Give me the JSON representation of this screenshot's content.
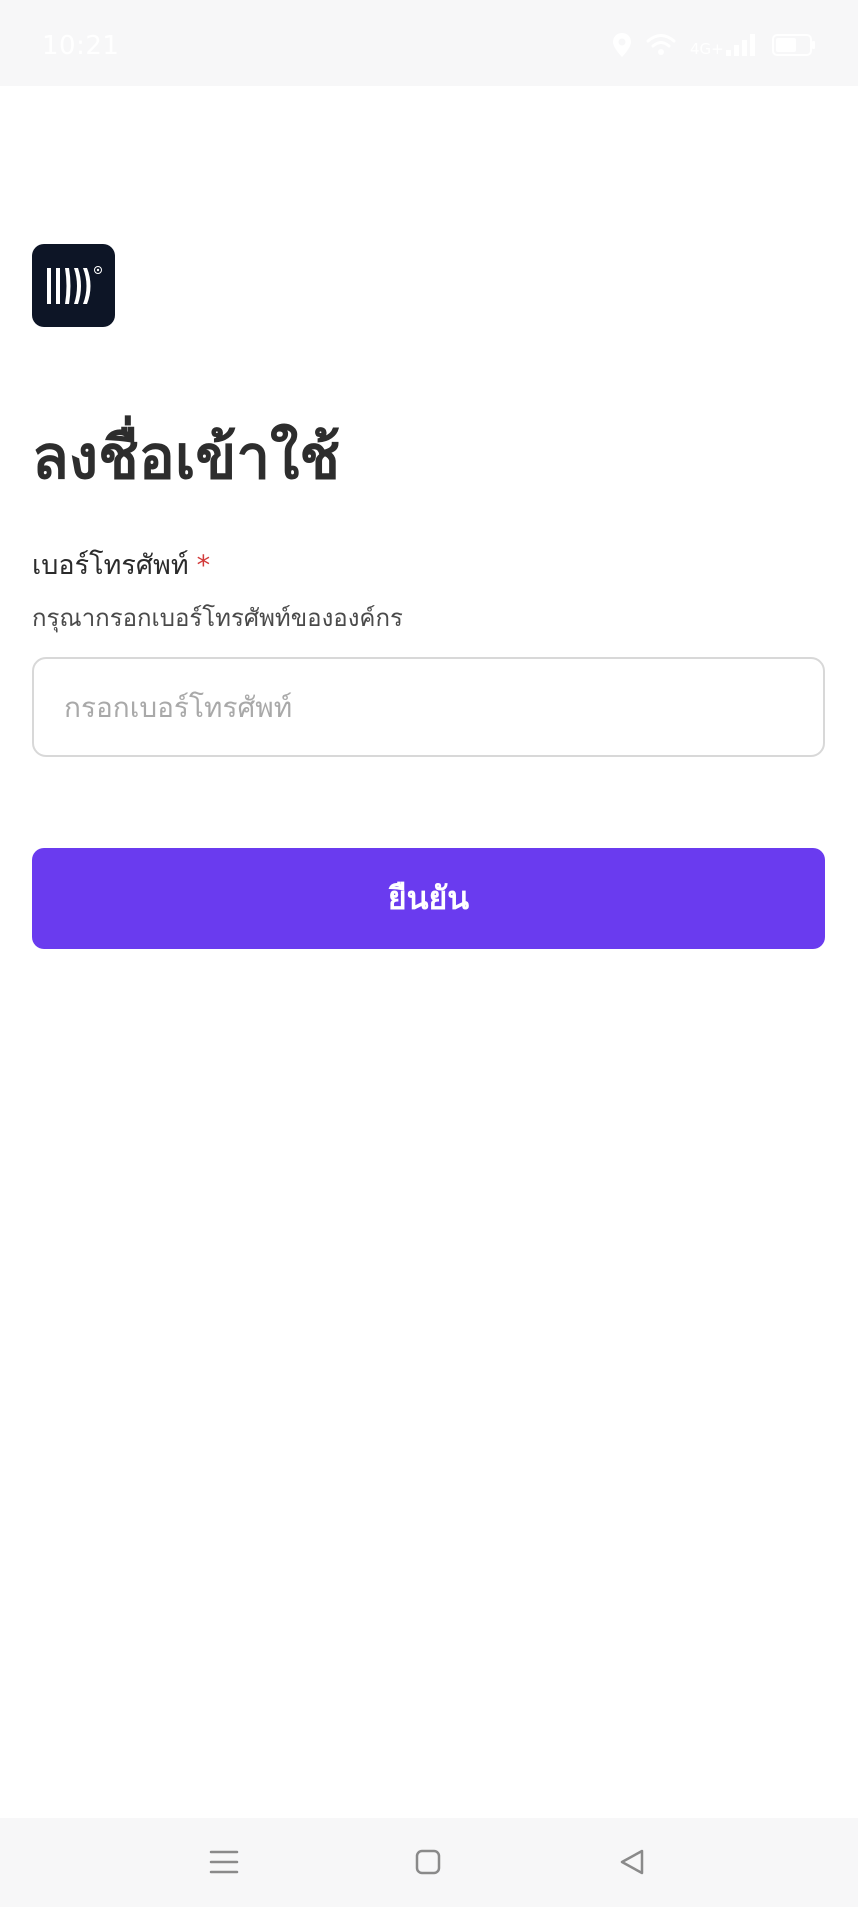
{
  "status_bar": {
    "time": "10:21",
    "icons": [
      "location-icon",
      "wifi-icon",
      "signal-icon",
      "battery-icon"
    ],
    "network_label": "4G+",
    "battery_level": "60"
  },
  "logo": {
    "icon": "brand-logo-icon",
    "background": "#0d1526"
  },
  "page": {
    "title": "ลงชื่อเข้าใช้"
  },
  "phone_field": {
    "label": "เบอร์โทรศัพท์",
    "required_mark": "*",
    "hint": "กรุณากรอกเบอร์โทรศัพท์ขององค์กร",
    "placeholder": "กรอกเบอร์โทรศัพท์",
    "value": ""
  },
  "confirm_button": {
    "label": "ยืนยัน",
    "color": "#6a3bef"
  },
  "nav_bar": {
    "icons": [
      "menu-icon",
      "home-icon",
      "back-icon"
    ]
  },
  "colors": {
    "accent": "#6a3bef",
    "required": "#d23a3a",
    "status_bar_bg": "#f7f7f8",
    "input_border": "#d8d8d8"
  }
}
